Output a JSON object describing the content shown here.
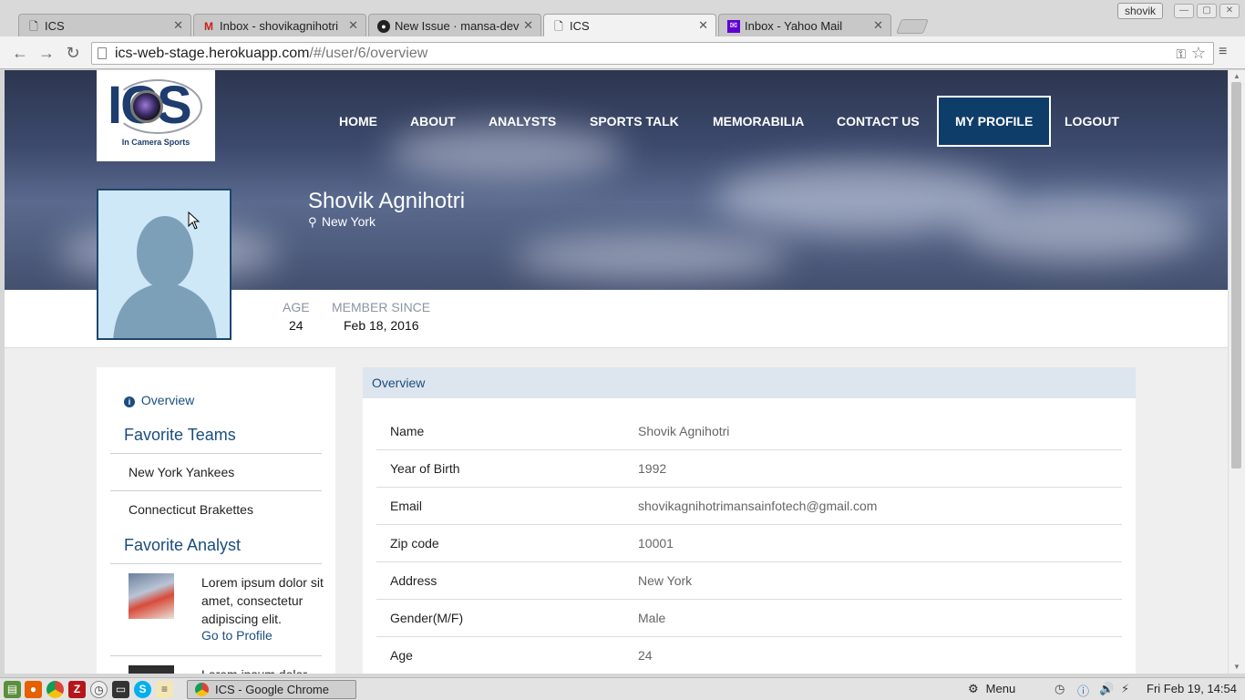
{
  "browser": {
    "tabs": [
      {
        "title": "ICS",
        "icon": "page-icon",
        "active": false
      },
      {
        "title": "Inbox - shovikagnihotri",
        "icon": "gmail-icon",
        "active": false
      },
      {
        "title": "New Issue · mansa-dev",
        "icon": "github-icon",
        "active": false
      },
      {
        "title": "ICS",
        "icon": "page-icon",
        "active": true
      },
      {
        "title": "Inbox - Yahoo Mail",
        "icon": "yahoo-icon",
        "active": false
      }
    ],
    "user_badge": "shovik",
    "url_host": "ics-web-stage.herokuapp.com",
    "url_path": "/#/user/6/overview"
  },
  "site": {
    "logo_text": "ICS",
    "logo_subtitle": "In Camera Sports",
    "nav": [
      {
        "label": "HOME",
        "active": false
      },
      {
        "label": "ABOUT",
        "active": false
      },
      {
        "label": "ANALYSTS",
        "active": false
      },
      {
        "label": "SPORTS TALK",
        "active": false
      },
      {
        "label": "MEMORABILIA",
        "active": false
      },
      {
        "label": "CONTACT US",
        "active": false
      },
      {
        "label": "MY PROFILE",
        "active": true
      },
      {
        "label": "LOGOUT",
        "active": false
      }
    ]
  },
  "profile": {
    "name": "Shovik Agnihotri",
    "location": "New York",
    "stats": [
      {
        "label": "AGE",
        "value": "24"
      },
      {
        "label": "MEMBER SINCE",
        "value": "Feb 18, 2016"
      }
    ]
  },
  "sidebar": {
    "overview_link": "Overview",
    "favorite_teams_heading": "Favorite Teams",
    "teams": [
      "New York Yankees",
      "Connecticut Brakettes"
    ],
    "favorite_analyst_heading": "Favorite Analyst",
    "analysts": [
      {
        "text": "Lorem ipsum dolor sit amet, consectetur adipiscing elit.",
        "link": "Go to Profile"
      },
      {
        "text": "Lorem ipsum dolor",
        "link": ""
      }
    ]
  },
  "overview": {
    "heading": "Overview",
    "rows": [
      {
        "label": "Name",
        "value": "Shovik Agnihotri"
      },
      {
        "label": "Year of Birth",
        "value": "1992"
      },
      {
        "label": "Email",
        "value": "shovikagnihotrimansainfotech@gmail.com"
      },
      {
        "label": "Zip code",
        "value": "10001"
      },
      {
        "label": "Address",
        "value": "New York"
      },
      {
        "label": "Gender(M/F)",
        "value": "Male"
      },
      {
        "label": "Age",
        "value": "24"
      }
    ]
  },
  "taskbar": {
    "window_title": "ICS - Google Chrome",
    "menu_label": "Menu",
    "clock": "Fri Feb 19, 14:54"
  },
  "colors": {
    "brand_navy": "#0f3d69",
    "link_blue": "#1b4d7e",
    "panel_header_bg": "#dde5ee"
  }
}
